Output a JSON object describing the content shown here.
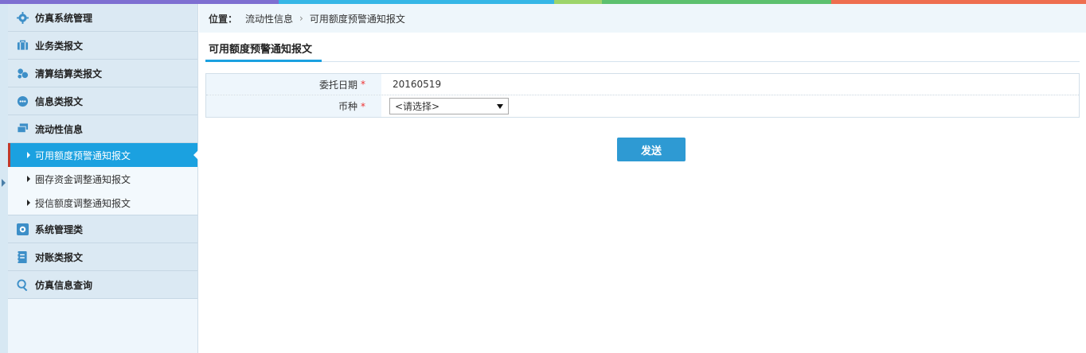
{
  "topbar_colors": [
    "#7e6fd1",
    "#35b6e6",
    "#9dd46a",
    "#5cc06e",
    "#ee6e4f"
  ],
  "sidebar": {
    "items": [
      {
        "label": "仿真系统管理",
        "icon": "gear-icon"
      },
      {
        "label": "业务类报文",
        "icon": "briefcase-icon"
      },
      {
        "label": "清算结算类报文",
        "icon": "coins-icon"
      },
      {
        "label": "信息类报文",
        "icon": "chat-icon"
      },
      {
        "label": "流动性信息",
        "icon": "stack-icon"
      }
    ],
    "subitems": [
      {
        "label": "可用额度预警通知报文"
      },
      {
        "label": "圈存资金调整通知报文"
      },
      {
        "label": "授信额度调整通知报文"
      }
    ],
    "items_after": [
      {
        "label": "系统管理类",
        "icon": "settings-box-icon"
      },
      {
        "label": "对账类报文",
        "icon": "ledger-icon"
      },
      {
        "label": "仿真信息查询",
        "icon": "search-icon"
      }
    ]
  },
  "breadcrumb": {
    "prefix": "位置：",
    "level1": "流动性信息",
    "separator": "›",
    "level2": "可用额度预警通知报文"
  },
  "tab": {
    "title": "可用额度预警通知报文"
  },
  "form": {
    "date_label": "委托日期",
    "date_value": "20160519",
    "currency_label": "币种",
    "currency_selected": "<请选择>",
    "required_mark": "*"
  },
  "send_label": "发送"
}
